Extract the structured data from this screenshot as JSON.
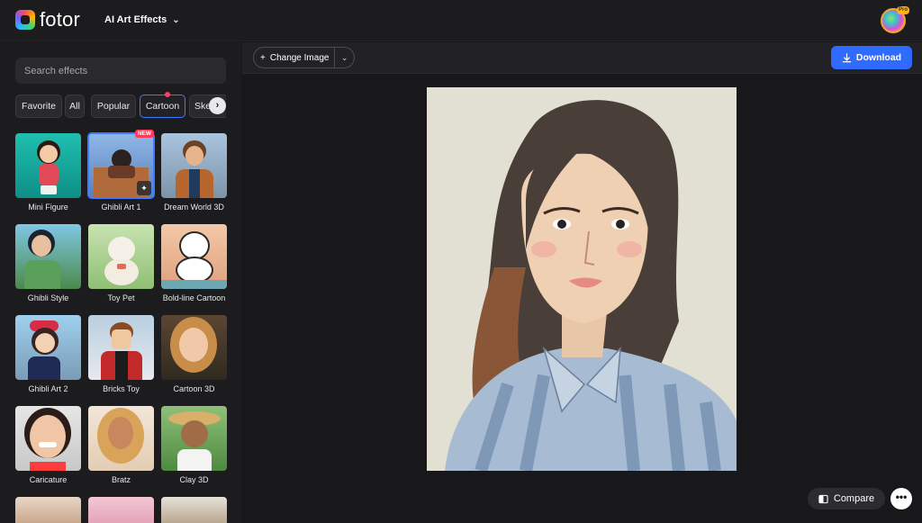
{
  "header": {
    "logo_text": "fotor",
    "menu_title": "AI Art Effects",
    "pro_badge": "Pro"
  },
  "sidebar": {
    "search_placeholder": "Search effects",
    "tabs": [
      "Favorite",
      "All",
      "Popular",
      "Cartoon",
      "Sketch"
    ],
    "active_tab": "Cartoon",
    "new_badge": "NEW",
    "effects": [
      {
        "label": "Mini Figure"
      },
      {
        "label": "Ghibli Art 1"
      },
      {
        "label": "Dream World 3D"
      },
      {
        "label": "Ghibli Style"
      },
      {
        "label": "Toy Pet"
      },
      {
        "label": "Bold-line Cartoon"
      },
      {
        "label": "Ghibli Art 2"
      },
      {
        "label": "Bricks Toy"
      },
      {
        "label": "Cartoon 3D"
      },
      {
        "label": "Caricature"
      },
      {
        "label": "Bratz"
      },
      {
        "label": "Clay 3D"
      }
    ]
  },
  "toolbar": {
    "change_image_label": "Change Image",
    "download_label": "Download"
  },
  "footer": {
    "compare_label": "Compare",
    "more_label": "•••"
  },
  "colors": {
    "accent": "#2f6bff",
    "background": "#18181b",
    "panel": "#1c1c1f",
    "new_badge": "#ff3d5a"
  }
}
